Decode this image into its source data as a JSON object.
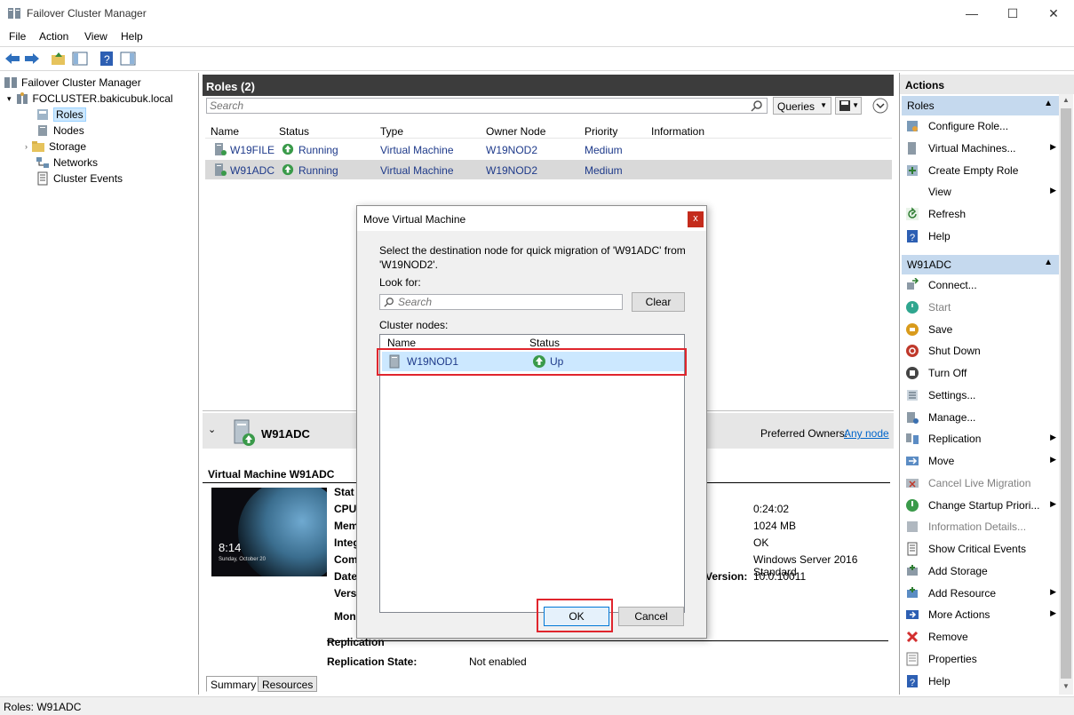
{
  "window": {
    "title": "Failover Cluster Manager",
    "minimize": "—",
    "maximize": "☐",
    "close": "✕"
  },
  "menu": [
    "File",
    "Action",
    "View",
    "Help"
  ],
  "tree": {
    "root": "Failover Cluster Manager",
    "cluster": "FOCLUSTER.bakicubuk.local",
    "items": [
      "Roles",
      "Nodes",
      "Storage",
      "Networks",
      "Cluster Events"
    ]
  },
  "roles_pane": {
    "header": "Roles (2)",
    "search_placeholder": "Search",
    "queries_label": "Queries",
    "columns": [
      "Name",
      "Status",
      "Type",
      "Owner Node",
      "Priority",
      "Information"
    ],
    "rows": [
      {
        "name": "W19FILE",
        "status": "Running",
        "type": "Virtual Machine",
        "owner": "W19NOD2",
        "priority": "Medium",
        "info": ""
      },
      {
        "name": "W91ADC",
        "status": "Running",
        "type": "Virtual Machine",
        "owner": "W19NOD2",
        "priority": "Medium",
        "info": ""
      }
    ]
  },
  "details": {
    "name": "W91ADC",
    "preferred_owners_label": "Preferred Owners:",
    "preferred_owners_value": "Any node",
    "vm_title": "Virtual Machine W91ADC",
    "thumbnail_time": "8:14",
    "thumbnail_date": "Sunday, October 20",
    "labels": [
      "Stat",
      "CPU",
      "Mem",
      "Integ",
      "Com",
      "Date",
      "Vers",
      "Mon"
    ],
    "version_label": "Version:",
    "values": [
      "0:24:02",
      "1024 MB",
      "OK",
      "Windows Server 2016 Standard",
      "10.0.10011"
    ],
    "replication_label": "Replication",
    "replication_state_label": "Replication State:",
    "replication_state_value": "Not enabled",
    "tabs": [
      "Summary",
      "Resources"
    ]
  },
  "actions": {
    "title": "Actions",
    "section_roles": "Roles",
    "roles_items": [
      {
        "label": "Configure Role...",
        "submenu": false
      },
      {
        "label": "Virtual Machines...",
        "submenu": true
      },
      {
        "label": "Create Empty Role",
        "submenu": false
      },
      {
        "label": "View",
        "submenu": true
      },
      {
        "label": "Refresh",
        "submenu": false
      },
      {
        "label": "Help",
        "submenu": false
      }
    ],
    "section_vm": "W91ADC",
    "vm_items": [
      {
        "label": "Connect...",
        "submenu": false,
        "disabled": false
      },
      {
        "label": "Start",
        "submenu": false,
        "disabled": true
      },
      {
        "label": "Save",
        "submenu": false,
        "disabled": false
      },
      {
        "label": "Shut Down",
        "submenu": false,
        "disabled": false
      },
      {
        "label": "Turn Off",
        "submenu": false,
        "disabled": false
      },
      {
        "label": "Settings...",
        "submenu": false,
        "disabled": false
      },
      {
        "label": "Manage...",
        "submenu": false,
        "disabled": false
      },
      {
        "label": "Replication",
        "submenu": true,
        "disabled": false
      },
      {
        "label": "Move",
        "submenu": true,
        "disabled": false
      },
      {
        "label": "Cancel Live Migration",
        "submenu": false,
        "disabled": true
      },
      {
        "label": "Change Startup Priori...",
        "submenu": true,
        "disabled": false
      },
      {
        "label": "Information Details...",
        "submenu": false,
        "disabled": true
      },
      {
        "label": "Show Critical Events",
        "submenu": false,
        "disabled": false
      },
      {
        "label": "Add Storage",
        "submenu": false,
        "disabled": false
      },
      {
        "label": "Add Resource",
        "submenu": true,
        "disabled": false
      },
      {
        "label": "More Actions",
        "submenu": true,
        "disabled": false
      },
      {
        "label": "Remove",
        "submenu": false,
        "disabled": false
      },
      {
        "label": "Properties",
        "submenu": false,
        "disabled": false
      },
      {
        "label": "Help",
        "submenu": false,
        "disabled": false
      }
    ]
  },
  "status_bar": "Roles:  W91ADC",
  "dialog": {
    "title": "Move Virtual Machine",
    "close": "x",
    "instruction": "Select the destination node for quick migration of 'W91ADC' from 'W19NOD2'.",
    "look_for_label": "Look for:",
    "search_placeholder": "Search",
    "clear_label": "Clear",
    "cluster_nodes_label": "Cluster nodes:",
    "columns": [
      "Name",
      "Status"
    ],
    "nodes": [
      {
        "name": "W19NOD1",
        "status": "Up"
      }
    ],
    "ok_label": "OK",
    "cancel_label": "Cancel"
  },
  "colors": {
    "accent_red": "#e0252d",
    "selection": "#cce8ff",
    "header_dark": "#3c3c3c",
    "section_blue": "#c5d9ee",
    "running_green": "#2e8b3d"
  }
}
